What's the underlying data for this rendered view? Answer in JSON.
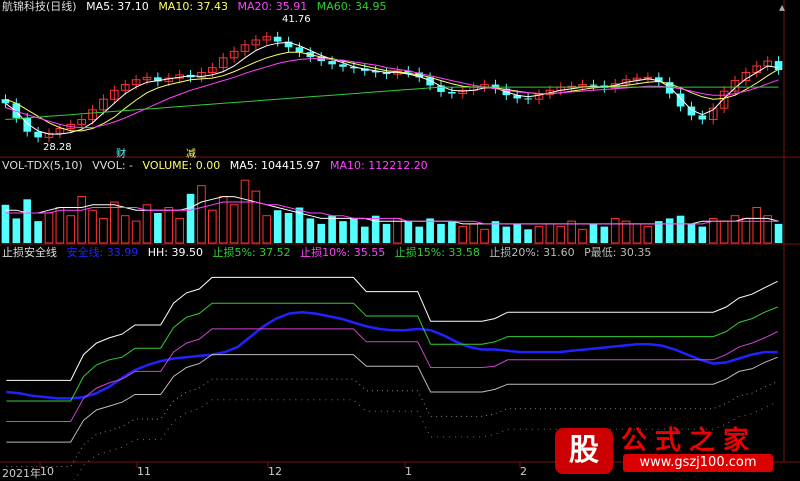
{
  "colors": {
    "up": "#ff3333",
    "down": "#54ffff",
    "ma5": "#ffffff",
    "ma10": "#ffff66",
    "ma20": "#ff44ff",
    "ma60": "#33cc33",
    "grid": "#7a1010",
    "line_blue": "#2222ff",
    "stop5": "#33cc33",
    "stop15": "#cc44cc"
  },
  "panel1": {
    "name": "航锦科技(日线)",
    "ma5_label": "MA5: 37.10",
    "ma10_label": "MA10: 37.43",
    "ma20_label": "MA20: 35.91",
    "ma60_label": "MA60: 34.95",
    "high_annot": "41.76",
    "low_annot": "28.28",
    "annot1": "财",
    "annot2": "减"
  },
  "panel2": {
    "name": "VOL-TDX(5,10)",
    "vvol_label": "VVOL: -",
    "volume_label": "VOLUME: 0.00",
    "ma5_label": "MA5: 104415.97",
    "ma10_label": "MA10: 112212.20"
  },
  "panel3": {
    "name": "止损安全线",
    "safe_label": "安全线: 33.99",
    "hh_label": "HH: 39.50",
    "stop5_label": "止损5%: 37.52",
    "stop10_label": "止损10%: 35.55",
    "stop15_label": "止损15%: 33.58",
    "stop20_label": "止损20%: 31.60",
    "pmin_label": "P最低: 30.35"
  },
  "xaxis": {
    "labels": [
      "2021年",
      "10",
      "11",
      "12",
      "1",
      "2"
    ]
  },
  "watermark": {
    "badge": "股",
    "title": "公式之家",
    "url": "www.gszj100.com"
  },
  "chart_data": [
    {
      "type": "candlestick",
      "title": "航锦科技(日线)",
      "ylim": [
        27,
        44
      ],
      "series": [
        {
          "name": "MA5",
          "values": [
            33.0,
            32.0,
            30.5,
            29.6,
            29.2,
            29.2,
            29.4,
            29.8,
            30.6,
            31.8,
            33.0,
            34.2,
            35.0,
            35.6,
            35.8,
            36.0,
            36.2,
            36.4,
            36.3,
            36.5,
            36.9,
            37.6,
            38.6,
            39.5,
            40.1,
            40.4,
            40.5,
            40.1,
            39.5,
            38.9,
            38.4,
            38.0,
            37.5,
            37.2,
            37.0,
            36.8,
            36.8,
            36.6,
            36.3,
            35.8,
            35.1,
            34.6,
            34.5,
            34.6,
            34.9,
            34.9,
            34.4,
            34.0,
            33.8,
            34.0,
            34.3,
            34.6,
            34.8,
            35.0,
            35.1,
            35.0,
            35.2,
            35.6,
            35.8,
            36.0,
            35.8,
            35.0,
            33.6,
            32.2,
            31.6,
            32.2,
            33.6,
            34.9,
            36.0,
            36.8,
            37.6,
            37.4
          ]
        },
        {
          "name": "MA10",
          "values": [
            33.5,
            33.0,
            32.2,
            31.4,
            30.6,
            30.0,
            29.6,
            29.6,
            29.9,
            30.5,
            31.3,
            32.4,
            33.4,
            34.3,
            34.9,
            35.3,
            35.6,
            35.9,
            36.0,
            36.1,
            36.4,
            36.9,
            37.5,
            38.1,
            38.6,
            39.0,
            39.3,
            39.3,
            39.0,
            38.7,
            38.5,
            38.2,
            37.9,
            37.6,
            37.3,
            37.0,
            36.9,
            36.7,
            36.5,
            36.2,
            35.8,
            35.4,
            35.1,
            35.0,
            35.0,
            34.9,
            34.7,
            34.5,
            34.3,
            34.2,
            34.2,
            34.3,
            34.5,
            34.7,
            34.9,
            35.0,
            35.1,
            35.2,
            35.4,
            35.6,
            35.7,
            35.4,
            34.9,
            34.3,
            33.8,
            33.5,
            33.6,
            34.0,
            34.7,
            35.5,
            36.4,
            37.2
          ]
        },
        {
          "name": "MA20",
          "values": [
            32.5,
            32.0,
            31.6,
            31.2,
            30.8,
            30.4,
            30.1,
            30.0,
            30.0,
            30.3,
            30.7,
            31.2,
            31.8,
            32.4,
            33.0,
            33.6,
            34.1,
            34.6,
            35.0,
            35.4,
            35.8,
            36.2,
            36.7,
            37.1,
            37.5,
            37.9,
            38.2,
            38.4,
            38.5,
            38.5,
            38.4,
            38.3,
            38.1,
            37.9,
            37.7,
            37.4,
            37.2,
            37.0,
            36.7,
            36.4,
            36.1,
            35.8,
            35.5,
            35.2,
            35.0,
            34.8,
            34.6,
            34.4,
            34.3,
            34.2,
            34.2,
            34.3,
            34.4,
            34.5,
            34.6,
            34.7,
            34.8,
            34.9,
            35.0,
            35.1,
            35.1,
            35.0,
            34.8,
            34.5,
            34.2,
            34.0,
            34.0,
            34.2,
            34.5,
            34.9,
            35.4,
            35.9
          ]
        },
        {
          "name": "MA60",
          "values": [
            31.0,
            31.1,
            31.2,
            31.3,
            31.4,
            31.5,
            31.6,
            31.7,
            31.8,
            31.9,
            32.0,
            32.1,
            32.2,
            32.3,
            32.4,
            32.5,
            32.6,
            32.7,
            32.8,
            32.9,
            33.0,
            33.1,
            33.2,
            33.3,
            33.4,
            33.5,
            33.6,
            33.7,
            33.8,
            33.9,
            34.0,
            34.1,
            34.2,
            34.3,
            34.4,
            34.5,
            34.6,
            34.7,
            34.8,
            34.9,
            35.0,
            35.0,
            35.0,
            35.0,
            35.0,
            35.0,
            35.0,
            35.0,
            35.0,
            35.0,
            35.0,
            35.0,
            35.0,
            35.0,
            35.0,
            35.0,
            35.0,
            35.0,
            35.0,
            35.0,
            35.0,
            35.0,
            35.0,
            35.0,
            35.0,
            35.0,
            35.0,
            35.0,
            35.0,
            35.0,
            35.0,
            35.0
          ]
        }
      ],
      "closes": [
        33.0,
        31.2,
        29.5,
        28.8,
        29.3,
        29.9,
        30.4,
        31.0,
        32.2,
        33.5,
        34.6,
        35.3,
        35.9,
        36.2,
        35.7,
        36.1,
        36.5,
        36.2,
        36.8,
        37.4,
        38.6,
        39.4,
        40.2,
        40.8,
        41.2,
        40.6,
        39.9,
        39.3,
        38.7,
        38.2,
        37.8,
        37.5,
        37.3,
        37.0,
        36.8,
        36.6,
        37.0,
        36.8,
        36.2,
        35.2,
        34.4,
        34.2,
        34.6,
        35.0,
        35.3,
        34.8,
        34.0,
        33.6,
        33.5,
        34.1,
        34.6,
        35.0,
        35.1,
        35.3,
        35.2,
        34.9,
        35.4,
        35.9,
        36.1,
        36.2,
        35.6,
        34.2,
        32.6,
        31.5,
        31.0,
        32.4,
        34.5,
        35.8,
        36.8,
        37.6,
        38.2,
        37.1
      ],
      "annotations": [
        "41.76",
        "28.28",
        "财",
        "减"
      ]
    },
    {
      "type": "bar",
      "title": "VOL-TDX(5,10)",
      "series": [
        {
          "name": "MA5",
          "values": [
            12,
            12,
            11,
            11,
            12,
            13,
            13,
            13,
            14,
            14,
            14,
            13,
            12,
            12,
            12,
            12,
            12,
            13,
            15,
            16,
            17,
            17,
            16,
            15,
            14,
            13,
            12,
            11,
            10,
            9,
            9,
            9,
            9,
            9,
            8,
            8,
            8,
            8,
            8,
            8,
            8,
            8,
            7,
            7,
            7,
            7,
            7,
            7,
            7,
            7,
            7,
            7,
            7,
            7,
            7,
            7,
            7,
            7,
            7,
            7,
            7,
            7,
            7,
            7,
            8,
            8,
            8,
            8,
            9,
            9,
            9,
            8
          ]
        },
        {
          "name": "MA10",
          "values": [
            11,
            11,
            11,
            11,
            11,
            12,
            12,
            12,
            13,
            13,
            13,
            13,
            13,
            12,
            12,
            12,
            12,
            12,
            13,
            14,
            15,
            15,
            15,
            15,
            14,
            14,
            13,
            12,
            11,
            11,
            10,
            10,
            9,
            9,
            9,
            9,
            9,
            8,
            8,
            8,
            8,
            8,
            8,
            8,
            7,
            7,
            7,
            7,
            7,
            7,
            7,
            7,
            7,
            7,
            7,
            7,
            7,
            7,
            7,
            7,
            7,
            7,
            7,
            7,
            7,
            8,
            8,
            8,
            8,
            8,
            8,
            8
          ]
        }
      ],
      "volumes": [
        14,
        9,
        16,
        8,
        11,
        13,
        10,
        17,
        12,
        9,
        15,
        10,
        8,
        14,
        11,
        13,
        9,
        18,
        21,
        12,
        17,
        14,
        23,
        19,
        10,
        12,
        11,
        13,
        9,
        7,
        10,
        8,
        9,
        6,
        10,
        7,
        9,
        8,
        6,
        9,
        7,
        8,
        6,
        7,
        5,
        8,
        6,
        7,
        5,
        6,
        7,
        6,
        8,
        5,
        7,
        6,
        9,
        8,
        7,
        6,
        8,
        9,
        10,
        7,
        6,
        9,
        8,
        10,
        9,
        13,
        10,
        7
      ]
    },
    {
      "type": "line",
      "title": "止损安全线",
      "series": [
        {
          "name": "安全线",
          "values": [
            30.9,
            30.8,
            30.6,
            30.5,
            30.4,
            30.4,
            30.5,
            30.8,
            31.3,
            32.0,
            32.6,
            33.0,
            33.3,
            33.5,
            33.6,
            33.7,
            33.8,
            34.0,
            34.4,
            35.2,
            36.0,
            36.6,
            37.0,
            37.1,
            37.0,
            36.8,
            36.6,
            36.3,
            36.0,
            35.8,
            35.7,
            35.7,
            35.8,
            35.7,
            35.3,
            34.8,
            34.4,
            34.2,
            34.2,
            34.1,
            34.0,
            34.0,
            34.0,
            34.0,
            34.1,
            34.2,
            34.3,
            34.4,
            34.5,
            34.6,
            34.6,
            34.5,
            34.2,
            33.8,
            33.4,
            33.1,
            33.2,
            33.5,
            33.8,
            34.0,
            34.0
          ]
        },
        {
          "name": "HH",
          "values": [
            31.8,
            31.8,
            31.8,
            31.8,
            31.8,
            31.8,
            33.8,
            34.7,
            35.1,
            35.4,
            36.1,
            36.1,
            36.1,
            37.8,
            38.6,
            38.9,
            39.8,
            39.8,
            39.8,
            39.8,
            39.8,
            39.8,
            39.8,
            39.8,
            39.8,
            39.8,
            39.8,
            39.8,
            38.7,
            38.7,
            38.7,
            38.7,
            38.7,
            36.4,
            36.4,
            36.4,
            36.4,
            36.4,
            36.6,
            37.1,
            37.1,
            37.1,
            37.1,
            37.1,
            37.1,
            37.1,
            37.1,
            37.1,
            37.1,
            37.1,
            37.1,
            37.1,
            37.1,
            37.1,
            37.1,
            37.1,
            37.5,
            38.2,
            38.5,
            39.0,
            39.5
          ]
        },
        {
          "name": "止损5%",
          "values": [
            30.2,
            30.2,
            30.2,
            30.2,
            30.2,
            30.2,
            32.1,
            33.0,
            33.4,
            33.6,
            34.3,
            34.3,
            34.3,
            35.9,
            36.7,
            37.0,
            37.8,
            37.8,
            37.8,
            37.8,
            37.8,
            37.8,
            37.8,
            37.8,
            37.8,
            37.8,
            37.8,
            37.8,
            36.8,
            36.8,
            36.8,
            36.8,
            36.8,
            34.6,
            34.6,
            34.6,
            34.6,
            34.6,
            34.8,
            35.2,
            35.2,
            35.2,
            35.2,
            35.2,
            35.2,
            35.2,
            35.2,
            35.2,
            35.2,
            35.2,
            35.2,
            35.2,
            35.2,
            35.2,
            35.2,
            35.2,
            35.6,
            36.3,
            36.6,
            37.1,
            37.5
          ]
        },
        {
          "name": "止损10%",
          "values": [
            28.6,
            28.6,
            28.6,
            28.6,
            28.6,
            28.6,
            30.4,
            31.2,
            31.6,
            31.9,
            32.5,
            32.5,
            32.5,
            34.0,
            34.7,
            35.0,
            35.8,
            35.8,
            35.8,
            35.8,
            35.8,
            35.8,
            35.8,
            35.8,
            35.8,
            35.8,
            35.8,
            35.8,
            34.8,
            34.8,
            34.8,
            34.8,
            34.8,
            32.8,
            32.8,
            32.8,
            32.8,
            32.8,
            32.9,
            33.4,
            33.4,
            33.4,
            33.4,
            33.4,
            33.4,
            33.4,
            33.4,
            33.4,
            33.4,
            33.4,
            33.4,
            33.4,
            33.4,
            33.4,
            33.4,
            33.4,
            33.8,
            34.4,
            34.7,
            35.1,
            35.6
          ]
        },
        {
          "name": "止损15%",
          "values": [
            27.0,
            27.0,
            27.0,
            27.0,
            27.0,
            27.0,
            28.7,
            29.5,
            29.8,
            30.1,
            30.7,
            30.7,
            30.7,
            32.1,
            32.8,
            33.1,
            33.8,
            33.8,
            33.8,
            33.8,
            33.8,
            33.8,
            33.8,
            33.8,
            33.8,
            33.8,
            33.8,
            33.8,
            32.9,
            32.9,
            32.9,
            32.9,
            32.9,
            30.9,
            30.9,
            30.9,
            30.9,
            30.9,
            31.1,
            31.5,
            31.5,
            31.5,
            31.5,
            31.5,
            31.5,
            31.5,
            31.5,
            31.5,
            31.5,
            31.5,
            31.5,
            31.5,
            31.5,
            31.5,
            31.5,
            31.5,
            31.9,
            32.5,
            32.7,
            33.2,
            33.6
          ]
        }
      ]
    }
  ]
}
